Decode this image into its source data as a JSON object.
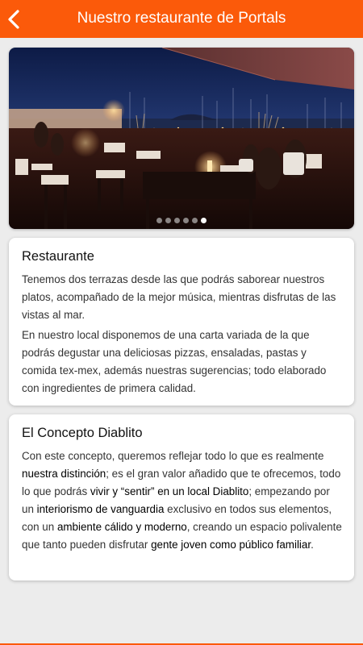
{
  "app_bar": {
    "title": "Nuestro restaurante de Portals",
    "back_icon": "chevron-left-icon",
    "color": "#fb5a0a"
  },
  "gallery": {
    "image": "Outdoor restaurant terrace at dusk overlooking a marina",
    "slide_count": 6,
    "active_slide": 6
  },
  "restaurante": {
    "title": "Restaurante",
    "p1": "Tenemos dos terrazas desde las que podrás saborear nuestros platos, acompañado de la mejor música, mientras disfrutas de las vistas al mar.",
    "p2": "En nuestro local disponemos de una carta variada de la que podrás degustar una deliciosas pizzas, ensaladas, pastas y comida tex-mex, además nuestras sugerencias; todo elaborado con ingredientes de primera calidad."
  },
  "concepto": {
    "title": "El Concepto Diablito",
    "t1": "Con este concepto, queremos reflejar todo lo que es realmente ",
    "b1": "nuestra distinción",
    "t2": "; es el gran valor añadido que te ofrecemos, todo lo que podrás ",
    "b2": "vivir y “sentir” en un local Diablito",
    "t3": "; empezando por un ",
    "b3": "interiorismo de vanguardia",
    "t4": " exclusivo en todos sus elementos, con un ",
    "b4": "ambiente cálido y moderno",
    "t5": ", creando un espacio polivalente que tanto pueden disfrutar ",
    "b5": "gente joven como público familiar",
    "t6": "."
  }
}
